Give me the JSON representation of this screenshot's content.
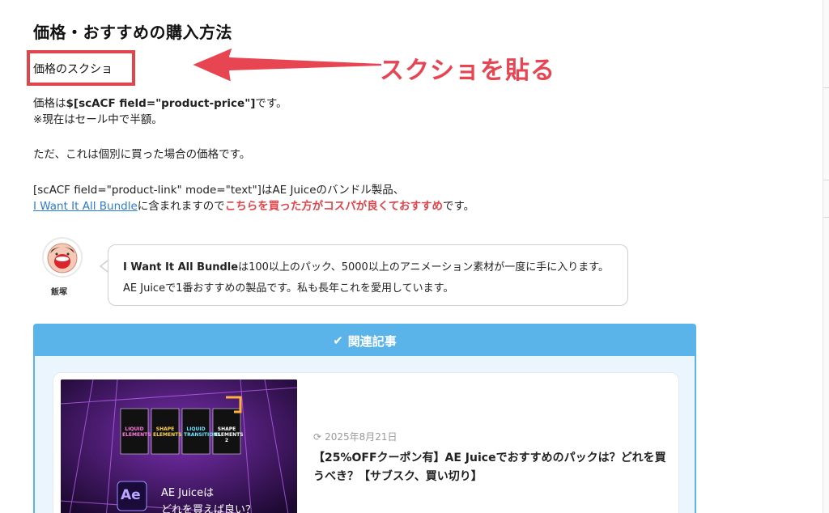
{
  "heading": "価格・おすすめの購入方法",
  "screenshot_placeholder": "価格のスクショ",
  "annotation": "スクショを貼る",
  "paragraphs": {
    "price_prefix": "価格は",
    "price_code": "$[scACF field=\"product-price\"]",
    "price_suffix": "です。",
    "sale_note": "※現在はセール中で半額。",
    "individual_note": "ただ、これは個別に買った場合の価格です。",
    "bundle_line1": "[scACF field=\"product-link\" mode=\"text\"]はAE Juiceのバンドル製品、",
    "bundle_link": "I Want It All Bundle",
    "bundle_mid": "に含まれますので",
    "bundle_emphasis": "こちらを買った方がコスパが良くておすすめ",
    "bundle_end": "です。"
  },
  "speech": {
    "author_name": "飯塚",
    "line1_bold": "I Want It All Bundle",
    "line1_rest": "は100以上のパック、5000以上のアニメーション素材が一度に手に入ります。",
    "line2": "AE Juiceで1番おすすめの製品です。私も長年これを愛用しています。"
  },
  "related": {
    "header": "関連記事",
    "check_icon": "✔",
    "card": {
      "date": "2025年8月21日",
      "title": "【25%OFFクーポン有】AE Juiceでおすすめのパックは？どれを買うべき？【サブスク、買い切り】",
      "thumb_ae": "Ae",
      "thumb_caption1": "AE Juiceは",
      "thumb_caption2": "どれを買えば良い？",
      "thumb_products": [
        "LIQUID ELEMENTS",
        "SHAPE ELEMENTS",
        "LIQUID TRANSITIONS",
        "SHAPE ELEMENTS 2"
      ]
    }
  },
  "colors": {
    "accent_red": "#e0454c",
    "link_blue": "#2b7bd0",
    "related_blue": "#5ab4ea",
    "related_bg": "#eaf5fd"
  }
}
